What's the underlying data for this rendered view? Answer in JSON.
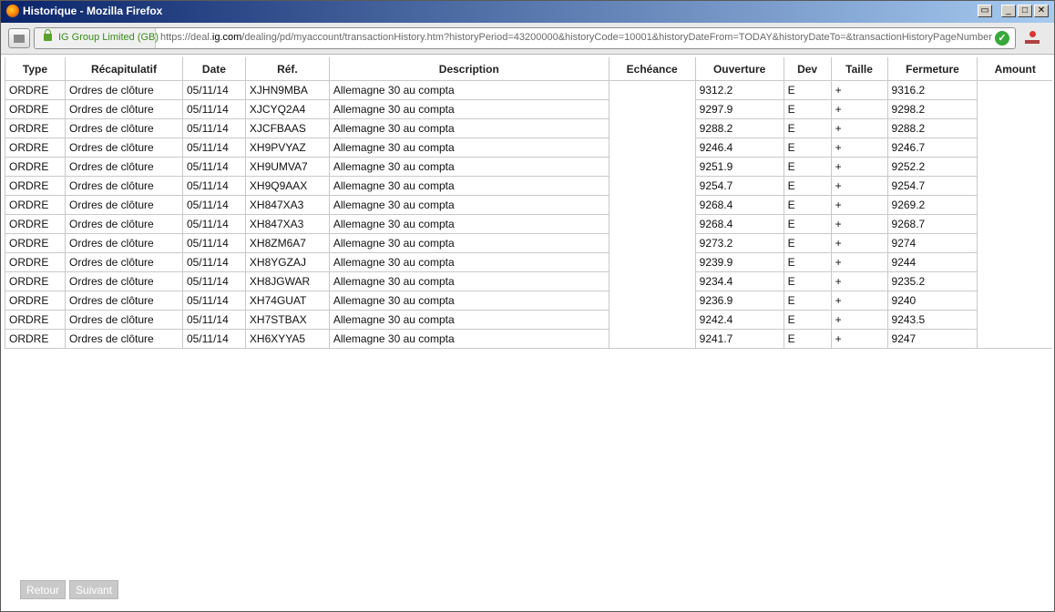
{
  "window": {
    "title": "Historique - Mozilla Firefox",
    "icon": "firefox-icon",
    "controls": [
      "restore-icon",
      "minimize-icon",
      "maximize-icon",
      "close-icon"
    ]
  },
  "navbar": {
    "identity": "IG Group Limited (GB)",
    "url_prefix": "https://deal.",
    "url_domain": "ig.com",
    "url_rest": "/dealing/pd/myaccount/transactionHistory.htm?historyPeriod=43200000&historyCode=10001&historyDateFrom=TODAY&historyDateTo=&transactionHistoryPageNumber"
  },
  "table": {
    "columns": [
      "Type",
      "Récapitulatif",
      "Date",
      "Réf.",
      "Description",
      "Echéance",
      "Ouverture",
      "Dev",
      "Taille",
      "Fermeture",
      "Amount"
    ],
    "rows": [
      {
        "type": "ORDRE",
        "recap": "Ordres de clôture",
        "date": "05/11/14",
        "ref": "XJHN9MBA",
        "desc": "Allemagne 30 au compta",
        "echeance": "",
        "ouverture": "9312.2",
        "dev": "E",
        "taille": "+",
        "fermeture": "9316.2",
        "amount": ""
      },
      {
        "type": "ORDRE",
        "recap": "Ordres de clôture",
        "date": "05/11/14",
        "ref": "XJCYQ2A4",
        "desc": "Allemagne 30 au compta",
        "echeance": "",
        "ouverture": "9297.9",
        "dev": "E",
        "taille": "+",
        "fermeture": "9298.2",
        "amount": ""
      },
      {
        "type": "ORDRE",
        "recap": "Ordres de clôture",
        "date": "05/11/14",
        "ref": "XJCFBAAS",
        "desc": "Allemagne 30 au compta",
        "echeance": "",
        "ouverture": "9288.2",
        "dev": "E",
        "taille": "+",
        "fermeture": "9288.2",
        "amount": ""
      },
      {
        "type": "ORDRE",
        "recap": "Ordres de clôture",
        "date": "05/11/14",
        "ref": "XH9PVYAZ",
        "desc": "Allemagne 30 au compta",
        "echeance": "",
        "ouverture": "9246.4",
        "dev": "E",
        "taille": "+",
        "fermeture": "9246.7",
        "amount": ""
      },
      {
        "type": "ORDRE",
        "recap": "Ordres de clôture",
        "date": "05/11/14",
        "ref": "XH9UMVA7",
        "desc": "Allemagne 30 au compta",
        "echeance": "",
        "ouverture": "9251.9",
        "dev": "E",
        "taille": "+",
        "fermeture": "9252.2",
        "amount": ""
      },
      {
        "type": "ORDRE",
        "recap": "Ordres de clôture",
        "date": "05/11/14",
        "ref": "XH9Q9AAX",
        "desc": "Allemagne 30 au compta",
        "echeance": "",
        "ouverture": "9254.7",
        "dev": "E",
        "taille": "+",
        "fermeture": "9254.7",
        "amount": ""
      },
      {
        "type": "ORDRE",
        "recap": "Ordres de clôture",
        "date": "05/11/14",
        "ref": "XH847XA3",
        "desc": "Allemagne 30 au compta",
        "echeance": "",
        "ouverture": "9268.4",
        "dev": "E",
        "taille": "+",
        "fermeture": "9269.2",
        "amount": ""
      },
      {
        "type": "ORDRE",
        "recap": "Ordres de clôture",
        "date": "05/11/14",
        "ref": "XH847XA3",
        "desc": "Allemagne 30 au compta",
        "echeance": "",
        "ouverture": "9268.4",
        "dev": "E",
        "taille": "+",
        "fermeture": "9268.7",
        "amount": ""
      },
      {
        "type": "ORDRE",
        "recap": "Ordres de clôture",
        "date": "05/11/14",
        "ref": "XH8ZM6A7",
        "desc": "Allemagne 30 au compta",
        "echeance": "",
        "ouverture": "9273.2",
        "dev": "E",
        "taille": "+",
        "fermeture": "9274",
        "amount": ""
      },
      {
        "type": "ORDRE",
        "recap": "Ordres de clôture",
        "date": "05/11/14",
        "ref": "XH8YGZAJ",
        "desc": "Allemagne 30 au compta",
        "echeance": "",
        "ouverture": "9239.9",
        "dev": "E",
        "taille": "+",
        "fermeture": "9244",
        "amount": ""
      },
      {
        "type": "ORDRE",
        "recap": "Ordres de clôture",
        "date": "05/11/14",
        "ref": "XH8JGWAR",
        "desc": "Allemagne 30 au compta",
        "echeance": "",
        "ouverture": "9234.4",
        "dev": "E",
        "taille": "+",
        "fermeture": "9235.2",
        "amount": ""
      },
      {
        "type": "ORDRE",
        "recap": "Ordres de clôture",
        "date": "05/11/14",
        "ref": "XH74GUAT",
        "desc": "Allemagne 30 au compta",
        "echeance": "",
        "ouverture": "9236.9",
        "dev": "E",
        "taille": "+",
        "fermeture": "9240",
        "amount": ""
      },
      {
        "type": "ORDRE",
        "recap": "Ordres de clôture",
        "date": "05/11/14",
        "ref": "XH7STBAX",
        "desc": "Allemagne 30 au compta",
        "echeance": "",
        "ouverture": "9242.4",
        "dev": "E",
        "taille": "+",
        "fermeture": "9243.5",
        "amount": ""
      },
      {
        "type": "ORDRE",
        "recap": "Ordres de clôture",
        "date": "05/11/14",
        "ref": "XH6XYYA5",
        "desc": "Allemagne 30 au compta",
        "echeance": "",
        "ouverture": "9241.7",
        "dev": "E",
        "taille": "+",
        "fermeture": "9247",
        "amount": ""
      }
    ]
  },
  "pager": {
    "back": "Retour",
    "next": "Suivant"
  }
}
